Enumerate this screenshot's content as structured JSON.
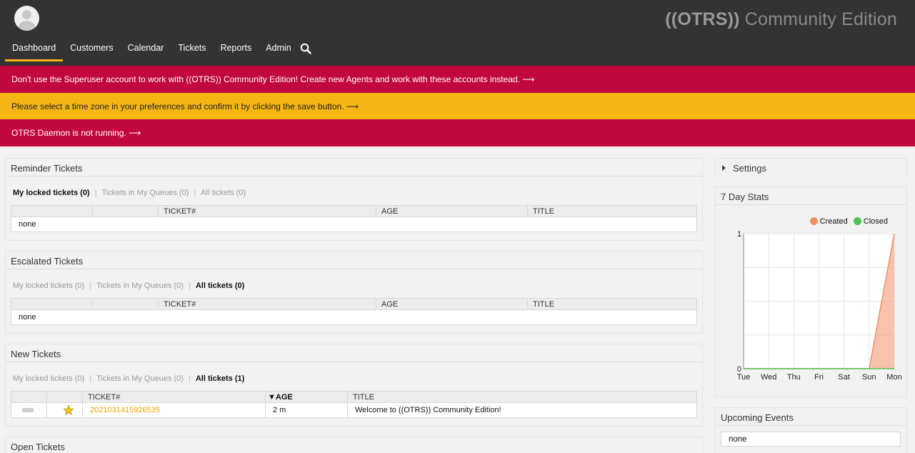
{
  "header": {
    "logo_brand": "((OTRS))",
    "logo_edition": "Community Edition",
    "nav": [
      "Dashboard",
      "Customers",
      "Calendar",
      "Tickets",
      "Reports",
      "Admin"
    ]
  },
  "notices": {
    "superuser": "Don't use the Superuser account to work with ((OTRS)) Community Edition! Create new Agents and work with these accounts instead. ⟶",
    "timezone": "Please select a time zone in your preferences and confirm it by clicking the save button. ⟶",
    "daemon": "OTRS Daemon is not running. ⟶"
  },
  "reminder": {
    "title": "Reminder Tickets",
    "filters": [
      "My locked tickets (0)",
      "Tickets in My Queues (0)",
      "All tickets (0)"
    ],
    "columns": [
      "",
      "",
      "TICKET#",
      "AGE",
      "TITLE"
    ],
    "empty": "none"
  },
  "escalated": {
    "title": "Escalated Tickets",
    "filters": [
      "My locked tickets (0)",
      "Tickets in My Queues (0)",
      "All tickets (0)"
    ],
    "columns": [
      "",
      "",
      "TICKET#",
      "AGE",
      "TITLE"
    ],
    "empty": "none"
  },
  "new_tickets": {
    "title": "New Tickets",
    "filters": [
      "My locked tickets (0)",
      "Tickets in My Queues (0)",
      "All tickets (1)"
    ],
    "columns": [
      "",
      "",
      "TICKET#",
      "▼AGE",
      "TITLE"
    ],
    "rows": [
      {
        "ticket": "2021031415926535",
        "age": "2 m",
        "title": "Welcome to ((OTRS)) Community Edition!"
      }
    ]
  },
  "open_tickets": {
    "title": "Open Tickets"
  },
  "settings": {
    "title": "Settings"
  },
  "stats": {
    "title": "7 Day Stats",
    "legend": [
      "Created",
      "Closed"
    ],
    "colors": {
      "created": "#f0916a",
      "closed": "#52c154"
    }
  },
  "upcoming": {
    "title": "Upcoming Events",
    "empty": "none"
  },
  "chart_data": {
    "type": "area",
    "categories": [
      "Tue",
      "Wed",
      "Thu",
      "Fri",
      "Sat",
      "Sun",
      "Mon"
    ],
    "series": [
      {
        "name": "Created",
        "values": [
          0,
          0,
          0,
          0,
          0,
          0,
          1
        ]
      },
      {
        "name": "Closed",
        "values": [
          0,
          0,
          0,
          0,
          0,
          0,
          0
        ]
      }
    ],
    "ylim": [
      0,
      1
    ],
    "yticks": [
      "0",
      "1"
    ],
    "grid": true,
    "legend": "top-right"
  }
}
